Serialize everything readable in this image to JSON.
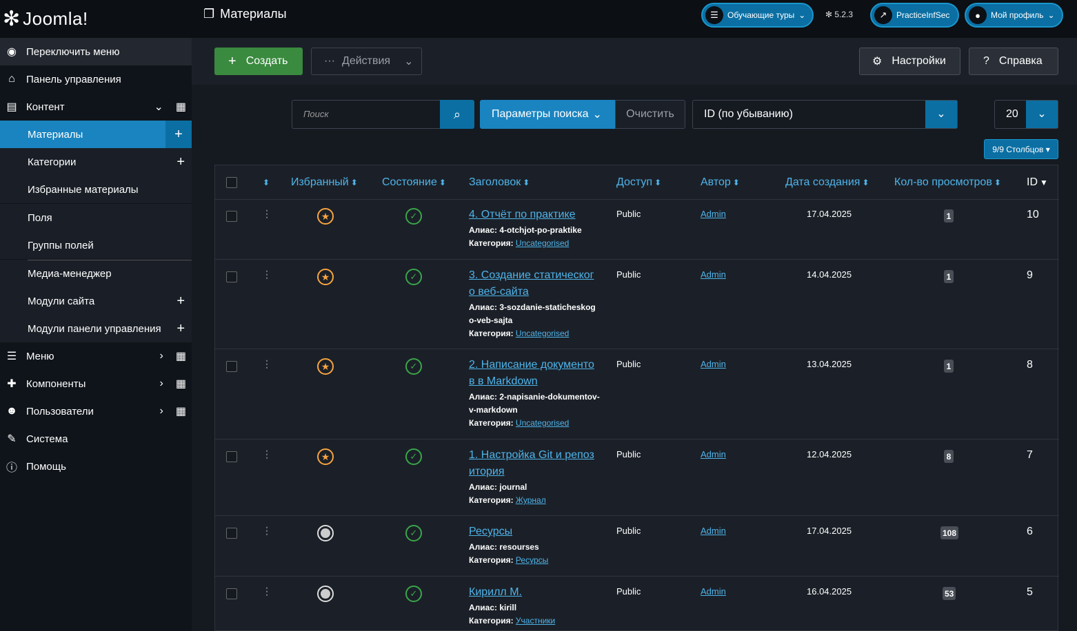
{
  "topbar": {
    "logo_text": "Joomla!",
    "page_title": "Материалы",
    "tours_label": "Обучающие туры",
    "version": "5.2.3",
    "site_label": "PracticeInfSec",
    "profile_label": "Мой профиль"
  },
  "sidebar": {
    "toggle": "Переключить меню",
    "dashboard": "Панель управления",
    "content": "Контент",
    "sub": [
      "Материалы",
      "Категории",
      "Избранные материалы",
      "Поля",
      "Группы полей",
      "Медиа-менеджер",
      "Модули сайта",
      "Модули панели управления"
    ],
    "menu": "Меню",
    "components": "Компоненты",
    "users": "Пользователи",
    "system": "Система",
    "help": "Помощь"
  },
  "toolbar": {
    "create": "Создать",
    "actions": "Действия",
    "settings": "Настройки",
    "help": "Справка"
  },
  "filters": {
    "search_placeholder": "Поиск",
    "search_options": "Параметры поиска",
    "clear": "Очистить",
    "sort": "ID (по убыванию)",
    "limit": "20",
    "columns": "9/9 Столбцов"
  },
  "table": {
    "headers": {
      "featured": "Избранный",
      "status": "Состояние",
      "title": "Заголовок",
      "access": "Доступ",
      "author": "Автор",
      "created": "Дата создания",
      "hits": "Кол-во просмотров",
      "id": "ID"
    },
    "alias_label": "Алиас:",
    "category_label": "Категория:",
    "rows": [
      {
        "title": "4. Отчёт по практике",
        "alias": "4-otchjot-po-praktike",
        "category": "Uncategorised",
        "access": "Public",
        "author": "Admin",
        "date": "17.04.2025",
        "hits": "1",
        "id": "10",
        "featured": true
      },
      {
        "title": "3. Создание статического веб-сайта",
        "alias": "3-sozdanie-staticheskogo-veb-sajta",
        "category": "Uncategorised",
        "access": "Public",
        "author": "Admin",
        "date": "14.04.2025",
        "hits": "1",
        "id": "9",
        "featured": true
      },
      {
        "title": "2. Написание документов в Markdown",
        "alias": "2-napisanie-dokumentov-v-markdown",
        "category": "Uncategorised",
        "access": "Public",
        "author": "Admin",
        "date": "13.04.2025",
        "hits": "1",
        "id": "8",
        "featured": true
      },
      {
        "title": "1. Настройка Git и репозитория",
        "alias": "journal",
        "category": "Журнал",
        "access": "Public",
        "author": "Admin",
        "date": "12.04.2025",
        "hits": "8",
        "id": "7",
        "featured": true
      },
      {
        "title": "Ресурсы",
        "alias": "resourses",
        "category": "Ресурсы",
        "access": "Public",
        "author": "Admin",
        "date": "17.04.2025",
        "hits": "108",
        "id": "6",
        "featured": false
      },
      {
        "title": "Кирилл М.",
        "alias": "kirill",
        "category": "Участники",
        "access": "Public",
        "author": "Admin",
        "date": "16.04.2025",
        "hits": "53",
        "id": "5",
        "featured": false
      }
    ]
  }
}
